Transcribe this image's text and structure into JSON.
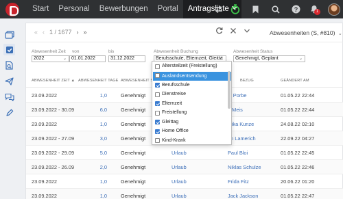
{
  "nav": {
    "items": [
      "Start",
      "Personal",
      "Bewerbungen",
      "Portal"
    ],
    "active": "Antragsliste",
    "notification_count": "1"
  },
  "icons": {
    "top": [
      "swap-icon",
      "stopwatch-icon",
      "bookmark-icon",
      "search-icon",
      "help-icon",
      "bell-icon"
    ],
    "sidebar": [
      "cards-icon",
      "check-square-icon",
      "document-search-icon",
      "send-icon",
      "chat-icon",
      "pen-icon"
    ]
  },
  "pager": {
    "label": "1 / 1677"
  },
  "view": {
    "label": "Abwesenheiten (S, #810)"
  },
  "filters": {
    "zeit_label": "Abwesenheit Zeit",
    "von_label": "von",
    "bis_label": "bis",
    "year": "2022",
    "von": "01.01.2022",
    "bis": "31.12.2022",
    "buchung_label": "Abwesenheit Buchung",
    "buchung_value": "Berufsschule, Elternzeit, Gleitta",
    "status_label": "Abwesenheit Status",
    "status_value": "Genehmigt, Geplant"
  },
  "table": {
    "headers": [
      "ABWESENHEIT ZEIT ▲",
      "ABWESENHEIT TAGE",
      "ABWESENHEIT STATUS",
      "BEZUG",
      "GEÄNDERT AM"
    ],
    "rows": [
      {
        "zeit": "23.09.2022",
        "tage": "1,0",
        "status": "Genehmigt",
        "typ": "",
        "person": "st Porbe",
        "geaendert": "01.05.22 22:44"
      },
      {
        "zeit": "23.09.2022 - 30.09",
        "tage": "6,0",
        "status": "Genehmigt",
        "typ": "",
        "person": "a Meis",
        "geaendert": "01.05.22 22:44"
      },
      {
        "zeit": "23.09.2022",
        "tage": "1,0",
        "status": "Genehmigt",
        "typ": "",
        "person": "elika Kunze",
        "geaendert": "24.08.22 02:10"
      },
      {
        "zeit": "23.09.2022 - 27.09",
        "tage": "3,0",
        "status": "Genehmigt",
        "typ": "",
        "person": "on Lamerich",
        "geaendert": "22.09.22 04:27"
      },
      {
        "zeit": "23.09.2022 - 29.09",
        "tage": "5,0",
        "status": "Genehmigt",
        "typ": "Urlaub",
        "person": "Paul Bloi",
        "geaendert": "01.05.22 22:45"
      },
      {
        "zeit": "23.09.2022 - 26.09",
        "tage": "2,0",
        "status": "Genehmigt",
        "typ": "Urlaub",
        "person": "Niklas Schulze",
        "geaendert": "01.05.22 22:46"
      },
      {
        "zeit": "23.09.2022",
        "tage": "1,0",
        "status": "Genehmigt",
        "typ": "Urlaub",
        "person": "Frida Fitz",
        "geaendert": "20.06.22 01:20"
      },
      {
        "zeit": "23.09.2022",
        "tage": "1,0",
        "status": "Genehmigt",
        "typ": "Urlaub",
        "person": "Jack Jackson",
        "geaendert": "01.05.22 22:47"
      }
    ]
  },
  "dropdown": {
    "items": [
      {
        "label": "Altersteilzeit (Freistellung)",
        "checked": false,
        "highlighted": false
      },
      {
        "label": "Auslandsentsendung",
        "checked": false,
        "highlighted": true
      },
      {
        "label": "Berufsschule",
        "checked": true,
        "highlighted": false
      },
      {
        "label": "Dienstreise",
        "checked": false,
        "highlighted": false
      },
      {
        "label": "Elternzeit",
        "checked": true,
        "highlighted": false
      },
      {
        "label": "Freistellung",
        "checked": false,
        "highlighted": false
      },
      {
        "label": "Gleittag",
        "checked": true,
        "highlighted": false
      },
      {
        "label": "Home Office",
        "checked": true,
        "highlighted": false
      },
      {
        "label": "Kind-Krank",
        "checked": false,
        "highlighted": false
      }
    ]
  },
  "colors": {
    "topbar": "#2f3133",
    "accent": "#3a93df",
    "link": "#3d6fb8",
    "notification": "#d9282f"
  }
}
